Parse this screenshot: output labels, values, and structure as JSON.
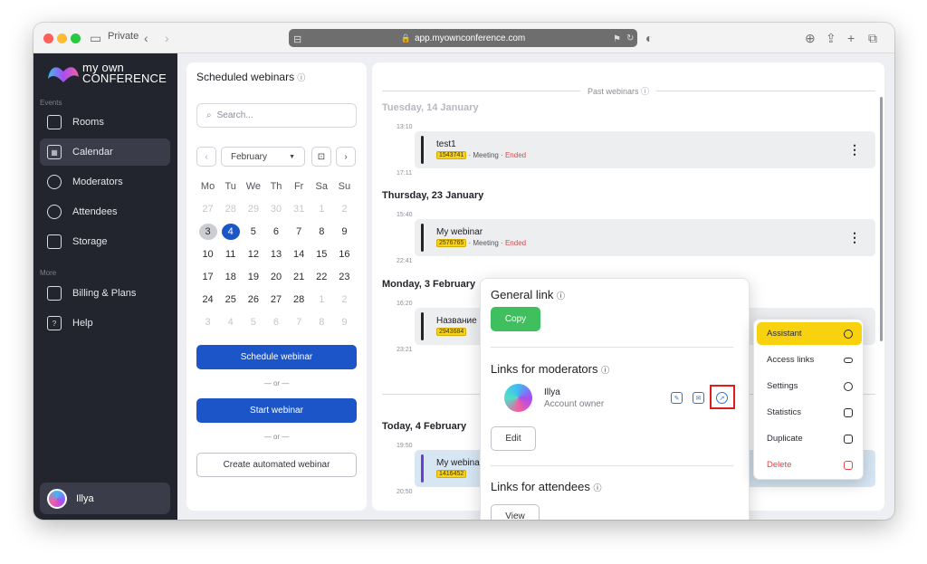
{
  "browser": {
    "private_label": "Private",
    "url": "app.myownconference.com"
  },
  "sidebar": {
    "logo_line1": "my own",
    "logo_line2": "CONFERENCE",
    "section_events": "Events",
    "section_more": "More",
    "items": [
      {
        "label": "Rooms",
        "icon": "cast-icon"
      },
      {
        "label": "Calendar",
        "icon": "calendar-icon"
      },
      {
        "label": "Moderators",
        "icon": "moderator-icon"
      },
      {
        "label": "Attendees",
        "icon": "attendees-icon"
      },
      {
        "label": "Storage",
        "icon": "storage-icon"
      },
      {
        "label": "Billing & Plans",
        "icon": "card-icon"
      },
      {
        "label": "Help",
        "icon": "help-icon"
      }
    ],
    "user_name": "Illya"
  },
  "scheduled": {
    "title": "Scheduled webinars",
    "search_placeholder": "Search...",
    "month": "February",
    "weekdays": [
      "Mo",
      "Tu",
      "We",
      "Th",
      "Fr",
      "Sa",
      "Su"
    ],
    "schedule_btn": "Schedule webinar",
    "or1": "— or —",
    "start_btn": "Start webinar",
    "or2": "— or —",
    "automated_btn": "Create automated webinar"
  },
  "past": {
    "divider_label": "Past webinars",
    "days": [
      {
        "label": "Tuesday, 14 January"
      },
      {
        "label": "Thursday, 23 January"
      },
      {
        "label": "Monday, 3 February"
      },
      {
        "label": "Today, 4 February"
      }
    ],
    "times": [
      "13:10",
      "17:11",
      "15:40",
      "22:41",
      "16:20",
      "23:21",
      "19:50",
      "20:50"
    ],
    "events": [
      {
        "title": "test1",
        "id": "1543741",
        "type": "Meeting",
        "status": "Ended"
      },
      {
        "title": "My webinar",
        "id": "2576765",
        "type": "Meeting",
        "status": "Ended"
      },
      {
        "title": "Название",
        "id": "2943684"
      },
      {
        "title": "My webina",
        "id": "1416452"
      }
    ]
  },
  "popup": {
    "general_link": "General link",
    "copy": "Copy",
    "links_moderators": "Links for moderators",
    "moderator_name": "Illya",
    "moderator_role": "Account owner",
    "edit": "Edit",
    "links_attendees": "Links for attendees",
    "view": "View"
  },
  "menu": {
    "items": [
      "Assistant",
      "Access links",
      "Settings",
      "Statistics",
      "Duplicate",
      "Delete"
    ]
  },
  "colors": {
    "accent_blue": "#1c55c8",
    "copy_green": "#3fbf5e",
    "highlight_yellow": "#f8d20f",
    "danger_red": "#e24545"
  }
}
